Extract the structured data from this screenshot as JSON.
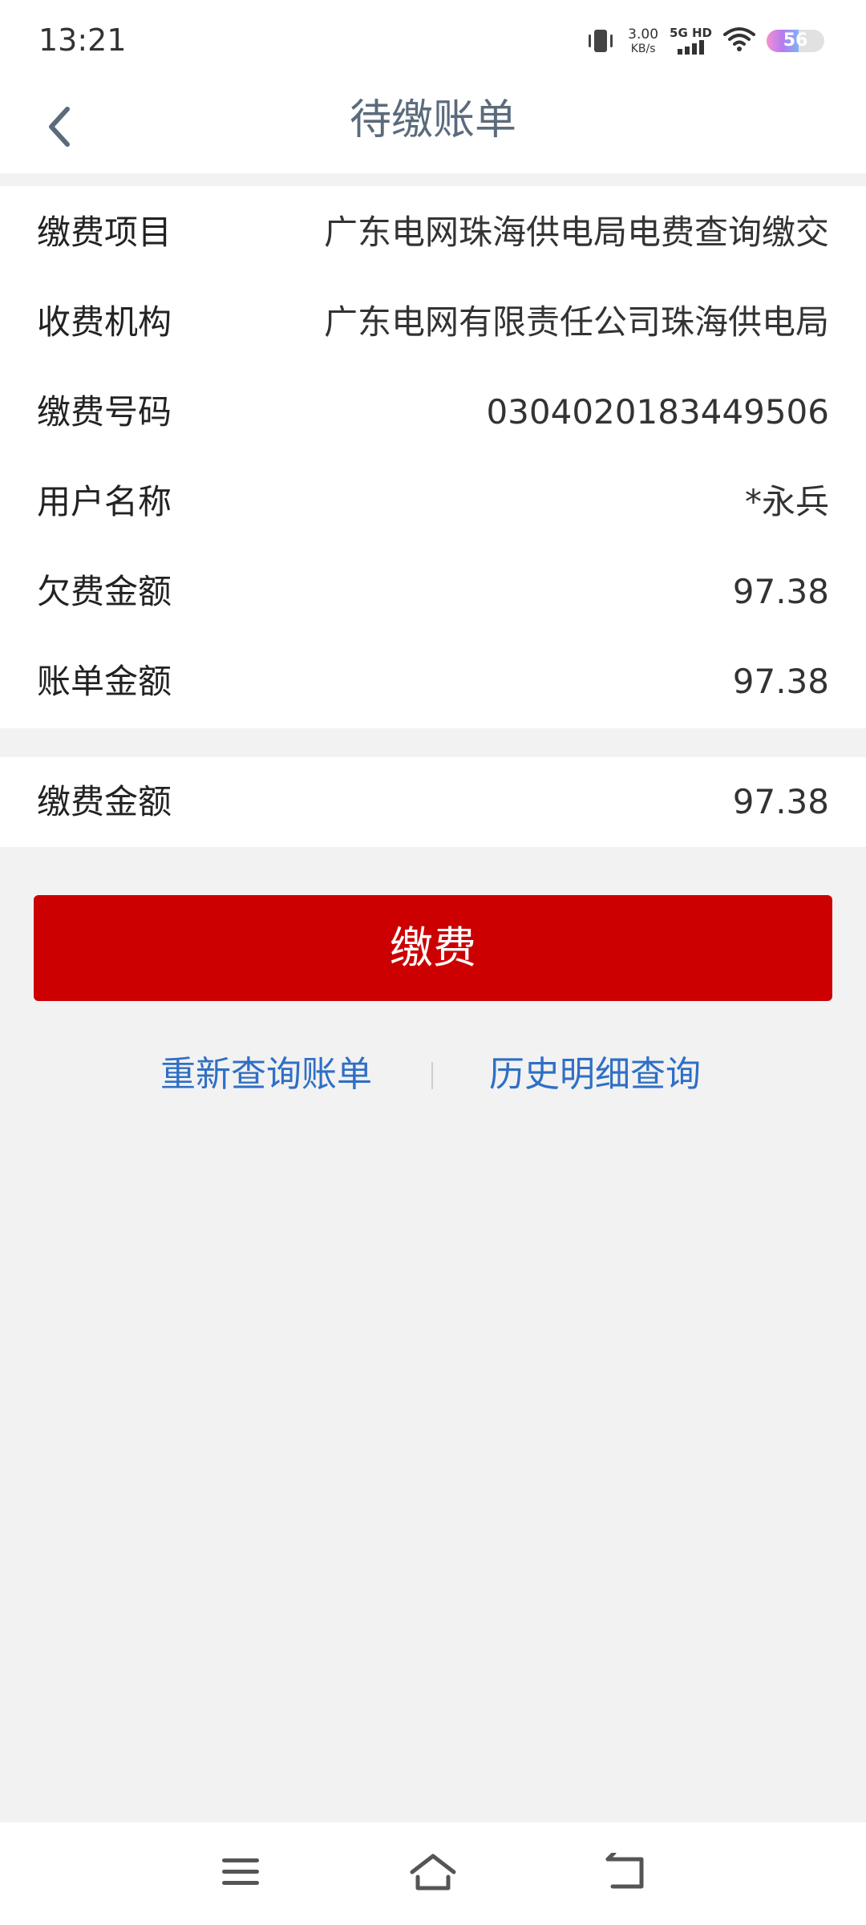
{
  "status_bar": {
    "time": "13:21",
    "net_speed_value": "3.00",
    "net_speed_unit": "KB/s",
    "signal_label": "5G HD",
    "battery_level": "56",
    "icons": [
      "vibrate-icon",
      "signal-icon",
      "wifi-icon",
      "battery-icon"
    ]
  },
  "nav": {
    "title": "待缴账单",
    "back_icon": "chevron-left-icon"
  },
  "bill": {
    "rows": [
      {
        "label": "缴费项目",
        "value": "广东电网珠海供电局电费查询缴交"
      },
      {
        "label": "收费机构",
        "value": "广东电网有限责任公司珠海供电局"
      },
      {
        "label": "缴费号码",
        "value": "0304020183449506"
      },
      {
        "label": "用户名称",
        "value": "*永兵"
      },
      {
        "label": "欠费金额",
        "value": "97.38"
      },
      {
        "label": "账单金额",
        "value": "97.38"
      }
    ]
  },
  "payment": {
    "label": "缴费金额",
    "value": "97.38"
  },
  "actions": {
    "pay_label": "缴费",
    "requery_label": "重新查询账单",
    "history_label": "历史明细查询"
  },
  "system_nav": {
    "icons": [
      "menu-icon",
      "home-icon",
      "back-icon"
    ]
  },
  "colors": {
    "accent": "#cc0000",
    "link": "#2f6fc5",
    "title": "#5b6b7c",
    "background": "#f2f2f2"
  }
}
